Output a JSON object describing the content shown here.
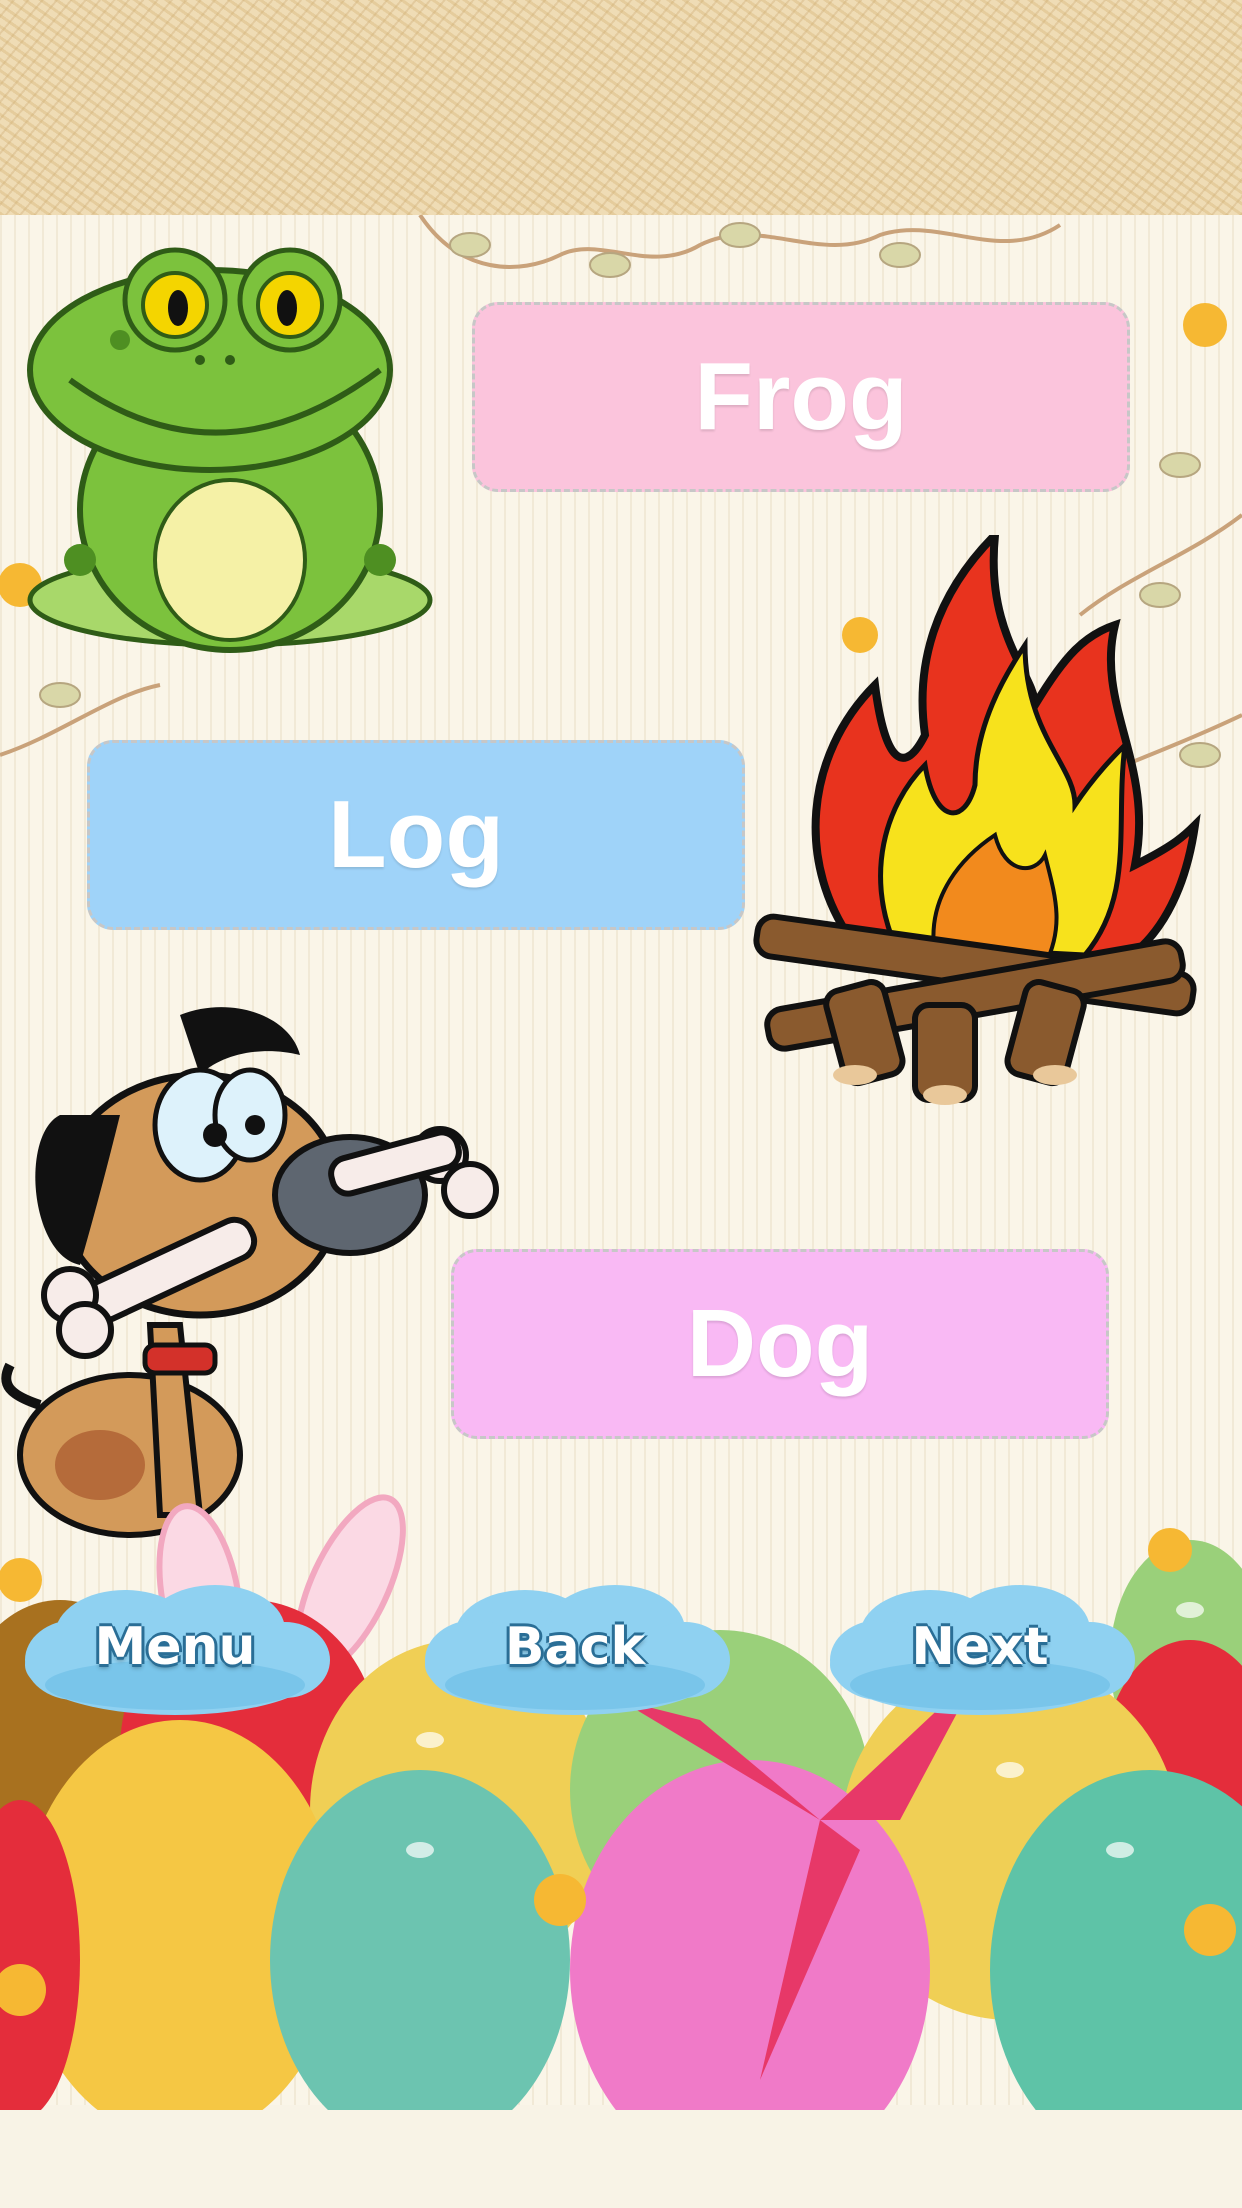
{
  "words": {
    "frog": "Frog",
    "log": "Log",
    "dog": "Dog"
  },
  "nav": {
    "menu": "Menu",
    "back": "Back",
    "next": "Next"
  },
  "colors": {
    "frog_button": "#fbc4dc",
    "log_button": "#9fd3f9",
    "dog_button": "#f9b9f4",
    "cloud_blue": "#7cc8ee"
  },
  "icons": [
    "frog-icon",
    "campfire-icon",
    "dog-icon",
    "easter-eggs",
    "bunny-ears"
  ]
}
